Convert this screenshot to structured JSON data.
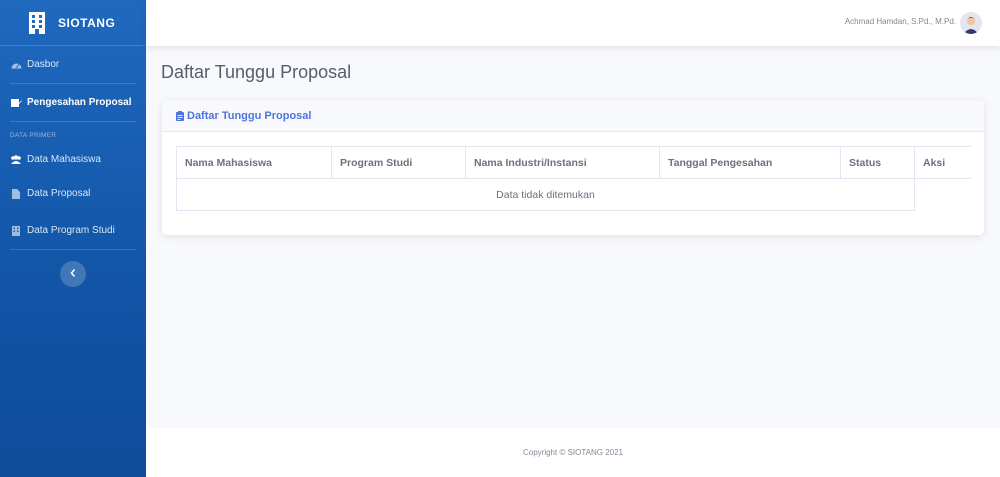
{
  "app": {
    "brand": "SIOTANG"
  },
  "sidebar": {
    "items": [
      {
        "label": "Dasbor",
        "icon": "tachometer-icon",
        "active": false
      },
      {
        "label": "Pengesahan Proposal",
        "icon": "signature-icon",
        "active": true
      }
    ],
    "section_heading": "DATA PRIMER",
    "section_items": [
      {
        "label": "Data Mahasiswa",
        "icon": "users-icon"
      },
      {
        "label": "Data Proposal",
        "icon": "file-icon"
      },
      {
        "label": "Data Program Studi",
        "icon": "building-icon"
      }
    ],
    "toggle_icon": "chevron-left-icon"
  },
  "topbar": {
    "user_name": "Achmad Hamdan, S.Pd., M.Pd."
  },
  "main": {
    "page_title": "Daftar Tunggu Proposal",
    "card_title": "Daftar Tunggu Proposal",
    "table": {
      "columns": [
        "Nama Mahasiswa",
        "Program Studi",
        "Nama Industri/Instansi",
        "Tanggal Pengesahan",
        "Status",
        "Aksi"
      ],
      "empty_message": "Data tidak ditemukan"
    }
  },
  "footer": {
    "copyright": "Copyright © SIOTANG 2021"
  },
  "colors": {
    "sidebar": "#1f69bf",
    "accent": "#4e73df",
    "background": "#f8f9fc"
  }
}
